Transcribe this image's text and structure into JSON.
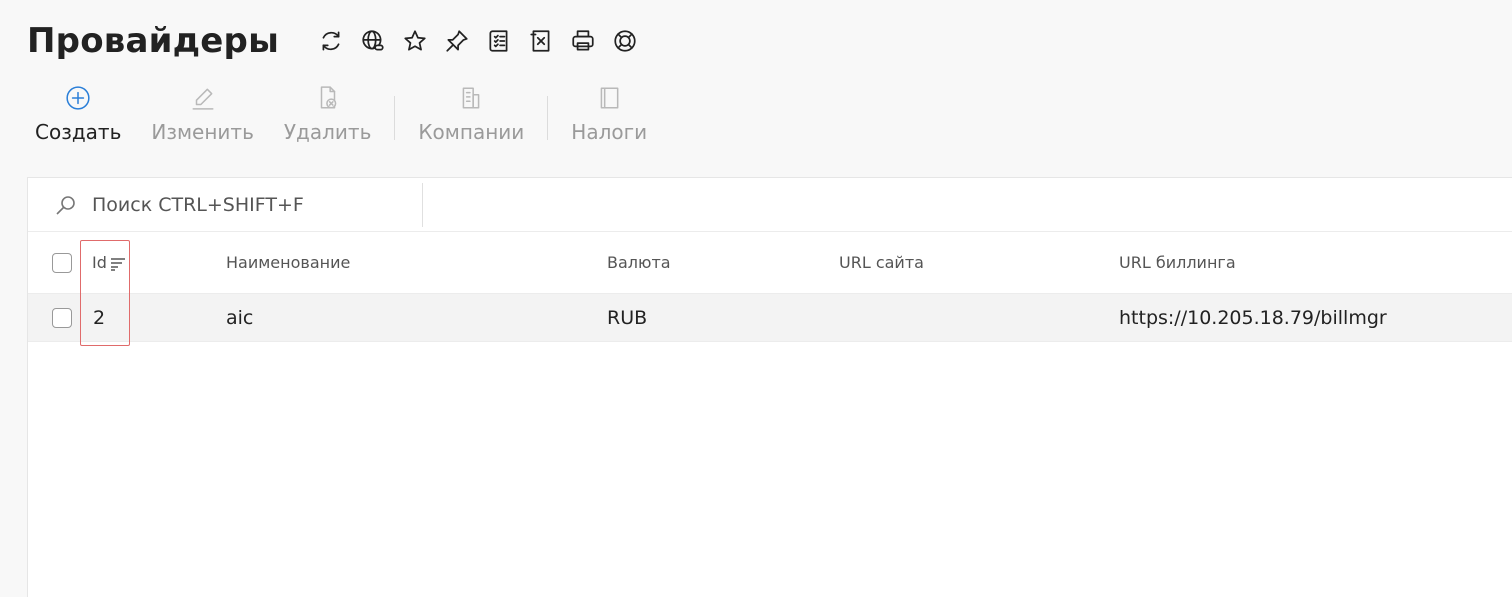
{
  "page": {
    "title": "Провайдеры"
  },
  "title_icons": [
    {
      "name": "refresh-icon"
    },
    {
      "name": "globe-link-icon"
    },
    {
      "name": "star-icon"
    },
    {
      "name": "pin-icon"
    },
    {
      "name": "checklist-icon"
    },
    {
      "name": "excel-export-icon"
    },
    {
      "name": "print-icon"
    },
    {
      "name": "help-lifebuoy-icon"
    }
  ],
  "toolbar": {
    "create_label": "Создать",
    "edit_label": "Изменить",
    "delete_label": "Удалить",
    "companies_label": "Компании",
    "taxes_label": "Налоги"
  },
  "search": {
    "placeholder": "Поиск CTRL+SHIFT+F",
    "value": ""
  },
  "table": {
    "columns": [
      "Id",
      "Наименование",
      "Валюта",
      "URL сайта",
      "URL биллинга"
    ],
    "sort": {
      "column": "Id"
    },
    "rows": [
      {
        "id": "2",
        "name": "aic",
        "currency": "RUB",
        "site_url": "",
        "billing_url": "https://10.205.18.79/billmgr"
      }
    ]
  },
  "colors": {
    "accent": "#2b7fd8",
    "highlight": "#e06b6b",
    "row_bg": "#f3f3f3",
    "panel_bg": "#ffffff",
    "page_bg": "#f8f8f8"
  }
}
